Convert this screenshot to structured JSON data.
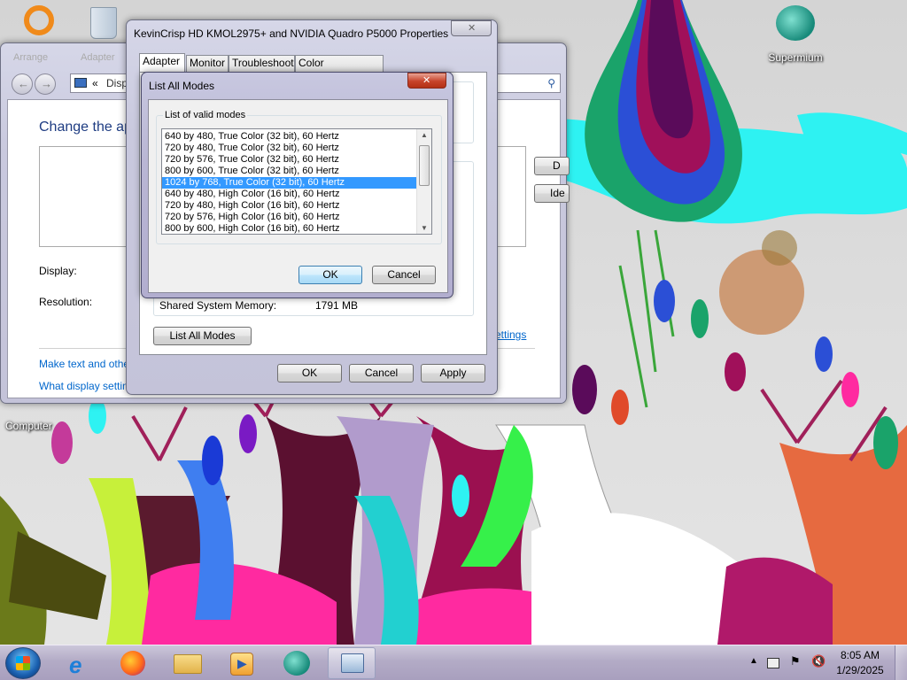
{
  "desktop": {
    "icons": [
      {
        "name": "recycle-bin",
        "label": ""
      },
      {
        "name": "supermium",
        "label": "Supermium"
      },
      {
        "name": "computer",
        "label": "Computer"
      }
    ]
  },
  "screen_resolution_window": {
    "nav_back_label": "«",
    "address_text": "Disp",
    "heading": "Change the ap",
    "display_label": "Display:",
    "resolution_label": "Resolution:",
    "right_btn1": "D",
    "right_btn2": "Ide",
    "advanced_link": "ettings",
    "make_text_link": "Make text and othe",
    "what_display_link": "What display settin",
    "faded_menu": "Arrange",
    "faded_menu2": "Adapter"
  },
  "properties_dialog": {
    "title": "KevinCrisp HD KMOL2975+ and NVIDIA Quadro P5000 Properties",
    "close_glyph": "✕",
    "tabs": [
      "Adapter",
      "Monitor",
      "Troubleshoot",
      "Color Management"
    ],
    "selected_tab": "Adapter",
    "shared_memory_label": "Shared System Memory:",
    "shared_memory_value": "1791 MB",
    "list_all_modes_button": "List All Modes",
    "ok_button": "OK",
    "cancel_button": "Cancel",
    "apply_button": "Apply"
  },
  "list_modes_dialog": {
    "title": "List All Modes",
    "close_glyph": "✕",
    "group_label": "List of valid modes",
    "modes": [
      "640 by 480, True Color (32 bit), 60 Hertz",
      "720 by 480, True Color (32 bit), 60 Hertz",
      "720 by 576, True Color (32 bit), 60 Hertz",
      "800 by 600, True Color (32 bit), 60 Hertz",
      "1024 by 768, True Color (32 bit), 60 Hertz",
      "640 by 480, High Color (16 bit), 60 Hertz",
      "720 by 480, High Color (16 bit), 60 Hertz",
      "720 by 576, High Color (16 bit), 60 Hertz",
      "800 by 600, High Color (16 bit), 60 Hertz"
    ],
    "selected_mode": "1024 by 768, True Color (32 bit), 60 Hertz",
    "ok_button": "OK",
    "cancel_button": "Cancel"
  },
  "taskbar": {
    "items": [
      "start-orb",
      "internet-explorer",
      "firefox",
      "windows-explorer",
      "media-player",
      "supermium",
      "display-settings"
    ],
    "active_item": "display-settings",
    "tray_icons": [
      "show-hidden-icons",
      "network",
      "action-center",
      "volume-muted"
    ],
    "clock_time": "8:05 AM",
    "clock_date": "1/29/2025"
  },
  "colors": {
    "selection": "#3399ff",
    "link": "#0066cc",
    "taskbar": "#b3abc6"
  }
}
